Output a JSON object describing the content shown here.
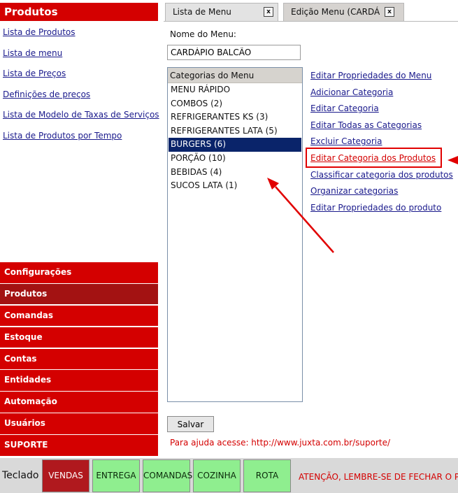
{
  "sidebar": {
    "title": "Produtos",
    "links": [
      "Lista de Produtos",
      "Lista de menu",
      "Lista de Preços",
      "Definições de preços",
      "Lista de Modelo de Taxas de Serviços",
      "Lista de Produtos por Tempo"
    ],
    "menu": [
      "Configurações",
      "Produtos",
      "Comandas",
      "Estoque",
      "Contas",
      "Entidades",
      "Automação",
      "Usuários",
      "SUPORTE"
    ],
    "active_menu": "Produtos"
  },
  "tabs": [
    {
      "label": "Lista de Menu",
      "close": "x"
    },
    {
      "label": "Edição Menu (CARDÁ",
      "close": "x"
    }
  ],
  "form": {
    "menu_name_label": "Nome do Menu:",
    "menu_name_value": "CARDÁPIO BALCÃO",
    "categories_header": "Categorias do Menu",
    "categories": [
      "MENU RÁPIDO",
      "COMBOS (2)",
      "REFRIGERANTES KS (3)",
      "REFRIGERANTES LATA (5)",
      "BURGERS (6)",
      "PORÇÃO (10)",
      "BEBIDAS (4)",
      "SUCOS LATA (1)"
    ],
    "selected_category": "BURGERS (6)",
    "save_label": "Salvar",
    "help_text": "Para ajuda acesse: http://www.juxta.com.br/suporte/"
  },
  "actions": [
    "Editar Propriedades do Menu",
    "Adicionar Categoria",
    "Editar Categoria",
    "Editar Todas as Categorias",
    "Excluir Categoria",
    "Editar Categoria dos Produtos",
    "Classificar categoria dos produtos",
    "Organizar categorias",
    "Editar Propriedades do produto"
  ],
  "highlighted_action": "Editar Categoria dos Produtos",
  "bottom_bar": {
    "keyboard_label": "Teclado",
    "buttons": [
      "VENDAS",
      "ENTREGA",
      "COMANDAS",
      "COZINHA",
      "ROTA"
    ],
    "warning": "ATENÇÃO, LEMBRE-SE DE FECHAR O P"
  },
  "colors": {
    "brand_red": "#d40000",
    "active_red": "#a31212",
    "selection_blue": "#0a246a",
    "green_button": "#8fee8f",
    "link_blue": "#1a1a8c",
    "annotation_red": "#e10000"
  }
}
